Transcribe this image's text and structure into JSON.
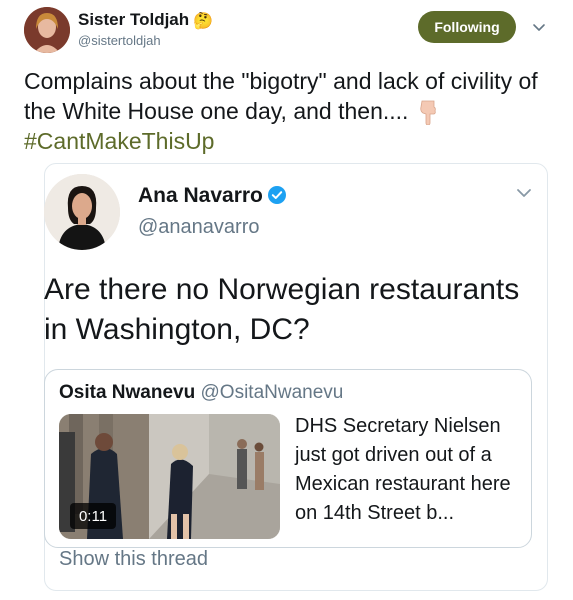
{
  "tweet": {
    "author_name": "Sister Toldjah",
    "author_emoji": "🤔",
    "author_handle": "@sistertoldjah",
    "follow_label": "Following",
    "text_main": "Complains about the \"bigotry\" and lack of civility of the White House one day, and then....",
    "hand_emoji": "👇",
    "hashtag": "#CantMakeThisUp"
  },
  "quoted": {
    "author_name": "Ana Navarro",
    "author_handle": "@ananavarro",
    "text": "Are there no Norwegian restaurants in Washington, DC?",
    "nested": {
      "author_name": "Osita Nwanevu",
      "author_handle": "@OsitaNwanevu",
      "text": "DHS Secretary Nielsen just got driven out of a Mexican restaurant here on 14th Street b...",
      "video_duration": "0:11"
    },
    "show_thread_label": "Show this thread"
  },
  "colors": {
    "accent": "#5d6b2a",
    "secondary_text": "#657786",
    "verified": "#1da1f2",
    "border": "#e1e8ed"
  },
  "icons": {
    "verified": "verified-badge-icon",
    "chevron": "chevron-down-icon"
  }
}
